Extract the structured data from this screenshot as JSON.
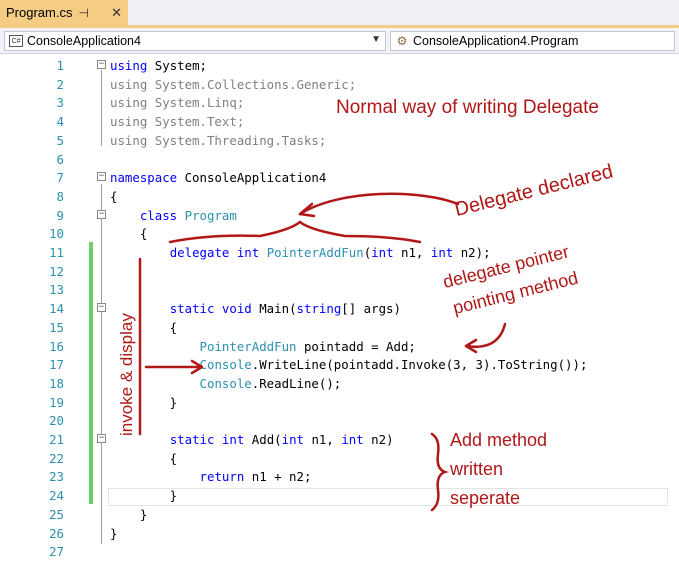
{
  "tab": {
    "title": "Program.cs",
    "pin_icon": "pin-icon",
    "close_icon": "close-icon"
  },
  "nav": {
    "left_combo": "ConsoleApplication4",
    "left_icon": "csharp-project-icon",
    "right_combo": "ConsoleApplication4.Program",
    "right_icon": "class-icon",
    "dropdown_icon": "chevron-down-icon"
  },
  "lines": [
    {
      "n": "1",
      "segs": [
        {
          "t": "using",
          "c": "kw"
        },
        {
          "t": " System;"
        }
      ]
    },
    {
      "n": "2",
      "segs": [
        {
          "t": "using System.Collections.Generic;",
          "c": "gray"
        }
      ]
    },
    {
      "n": "3",
      "segs": [
        {
          "t": "using System.Linq;",
          "c": "gray"
        }
      ]
    },
    {
      "n": "4",
      "segs": [
        {
          "t": "using System.Text;",
          "c": "gray"
        }
      ]
    },
    {
      "n": "5",
      "segs": [
        {
          "t": "using System.Threading.Tasks;",
          "c": "gray"
        }
      ]
    },
    {
      "n": "6",
      "segs": []
    },
    {
      "n": "7",
      "segs": [
        {
          "t": "namespace",
          "c": "kw"
        },
        {
          "t": " ConsoleApplication4"
        }
      ]
    },
    {
      "n": "8",
      "segs": [
        {
          "t": "{"
        }
      ]
    },
    {
      "n": "9",
      "segs": [
        {
          "t": "    "
        },
        {
          "t": "class",
          "c": "kw"
        },
        {
          "t": " "
        },
        {
          "t": "Program",
          "c": "ty"
        }
      ]
    },
    {
      "n": "10",
      "segs": [
        {
          "t": "    {"
        }
      ]
    },
    {
      "n": "11",
      "segs": [
        {
          "t": "        "
        },
        {
          "t": "delegate",
          "c": "kw"
        },
        {
          "t": " "
        },
        {
          "t": "int",
          "c": "kw"
        },
        {
          "t": " "
        },
        {
          "t": "PointerAddFun",
          "c": "ty"
        },
        {
          "t": "("
        },
        {
          "t": "int",
          "c": "kw"
        },
        {
          "t": " n1, "
        },
        {
          "t": "int",
          "c": "kw"
        },
        {
          "t": " n2);"
        }
      ]
    },
    {
      "n": "12",
      "segs": []
    },
    {
      "n": "13",
      "segs": []
    },
    {
      "n": "14",
      "segs": [
        {
          "t": "        "
        },
        {
          "t": "static",
          "c": "kw"
        },
        {
          "t": " "
        },
        {
          "t": "void",
          "c": "kw"
        },
        {
          "t": " Main("
        },
        {
          "t": "string",
          "c": "kw"
        },
        {
          "t": "[] args)"
        }
      ]
    },
    {
      "n": "15",
      "segs": [
        {
          "t": "        {"
        }
      ]
    },
    {
      "n": "16",
      "segs": [
        {
          "t": "            "
        },
        {
          "t": "PointerAddFun",
          "c": "ty"
        },
        {
          "t": " pointadd = Add;"
        }
      ]
    },
    {
      "n": "17",
      "segs": [
        {
          "t": "            "
        },
        {
          "t": "Console",
          "c": "ty"
        },
        {
          "t": ".WriteLine(pointadd.Invoke(3, 3).ToString());"
        }
      ]
    },
    {
      "n": "18",
      "segs": [
        {
          "t": "            "
        },
        {
          "t": "Console",
          "c": "ty"
        },
        {
          "t": ".ReadLine();"
        }
      ]
    },
    {
      "n": "19",
      "segs": [
        {
          "t": "        }"
        }
      ]
    },
    {
      "n": "20",
      "segs": []
    },
    {
      "n": "21",
      "segs": [
        {
          "t": "        "
        },
        {
          "t": "static",
          "c": "kw"
        },
        {
          "t": " "
        },
        {
          "t": "int",
          "c": "kw"
        },
        {
          "t": " Add("
        },
        {
          "t": "int",
          "c": "kw"
        },
        {
          "t": " n1, "
        },
        {
          "t": "int",
          "c": "kw"
        },
        {
          "t": " n2)"
        }
      ]
    },
    {
      "n": "22",
      "segs": [
        {
          "t": "        {"
        }
      ]
    },
    {
      "n": "23",
      "segs": [
        {
          "t": "            "
        },
        {
          "t": "return",
          "c": "kw"
        },
        {
          "t": " n1 + n2;"
        }
      ]
    },
    {
      "n": "24",
      "segs": [
        {
          "t": "        }"
        }
      ]
    },
    {
      "n": "25",
      "segs": [
        {
          "t": "    }"
        }
      ]
    },
    {
      "n": "26",
      "segs": [
        {
          "t": "}"
        }
      ]
    },
    {
      "n": "27",
      "segs": []
    }
  ],
  "annotations": {
    "title": "Normal way of writing Delegate",
    "delegate_declared": "Delegate declared",
    "delegate_pointer_1": "delegate pointer",
    "delegate_pointer_2": "pointing method",
    "invoke_display": "invoke & display",
    "add_method_1": "Add method",
    "add_method_2": "written",
    "add_method_3": "seperate"
  },
  "colors": {
    "keyword": "#0000ff",
    "type": "#2b91af",
    "annotation": "#b01818",
    "tab_active": "#f5cc84"
  }
}
